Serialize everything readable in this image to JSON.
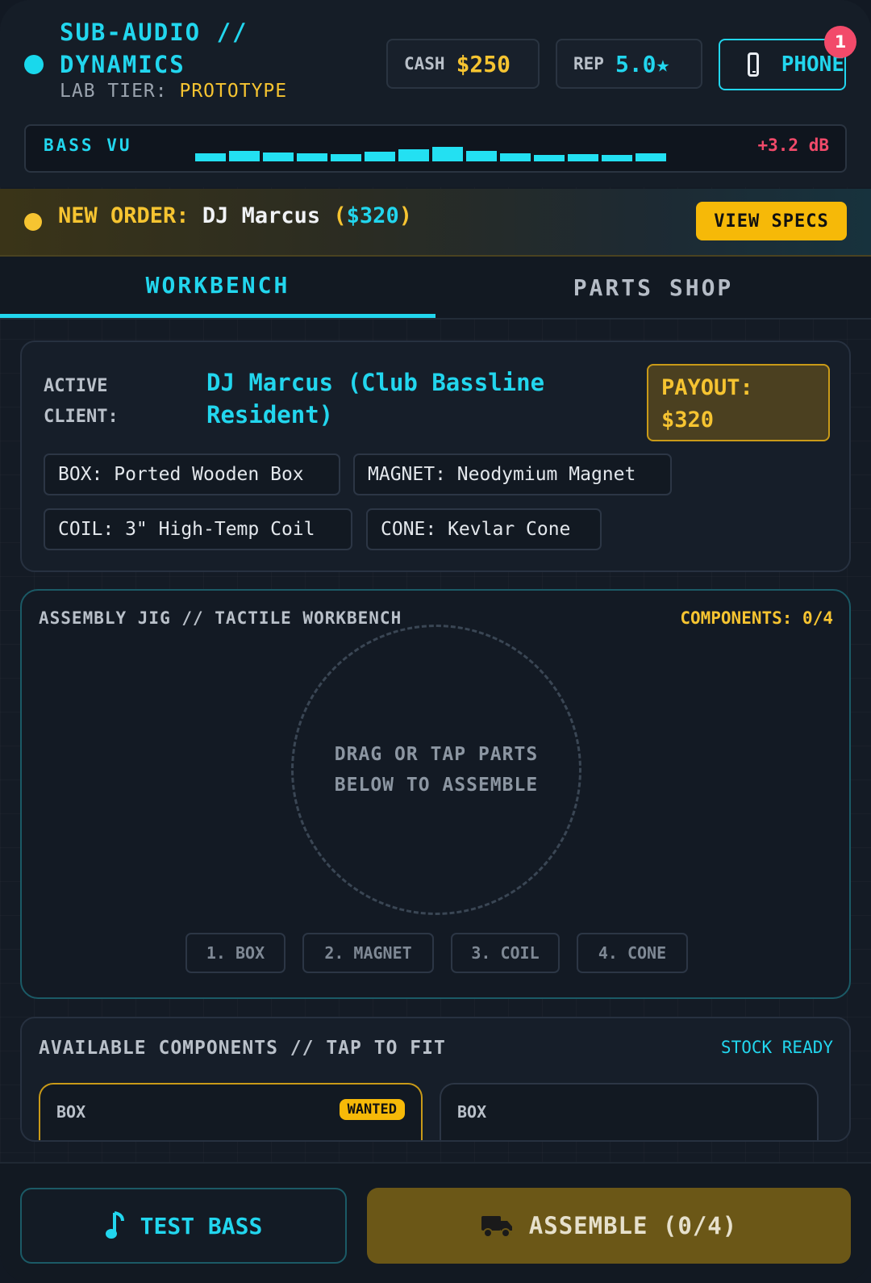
{
  "header": {
    "brand_line1": "SUB-AUDIO //",
    "brand_line2": "DYNAMICS",
    "tier_label": "LAB TIER:",
    "tier_value": "PROTOTYPE",
    "cash_label": "CASH",
    "cash_value": "$250",
    "rep_label": "REP",
    "rep_value": "5.0★",
    "phone_label": "PHONE",
    "phone_badge": "1"
  },
  "vu": {
    "label": "BASS VU",
    "db": "+3.2 dB",
    "levels": [
      0.35,
      0.55,
      0.45,
      0.38,
      0.32,
      0.5,
      0.7,
      0.85,
      0.55,
      0.35,
      0.28,
      0.3,
      0.28,
      0.38
    ]
  },
  "order": {
    "prefix": "NEW ORDER:",
    "client": "DJ Marcus",
    "amount": "$320",
    "button": "VIEW SPECS"
  },
  "tabs": [
    {
      "label": "WORKBENCH",
      "active": true
    },
    {
      "label": "PARTS SHOP",
      "active": false
    }
  ],
  "client": {
    "label_line1": "ACTIVE",
    "label_line2": "CLIENT:",
    "name_line1": "DJ Marcus (Club Bassline",
    "name_line2": "Resident)",
    "payout_label": "PAYOUT:",
    "payout_value": "$320",
    "specs": [
      "BOX: Ported Wooden Box",
      "MAGNET: Neodymium Magnet",
      "COIL: 3\" High-Temp Coil",
      "CONE: Kevlar Cone"
    ]
  },
  "jig": {
    "title": "ASSEMBLY JIG // TACTILE WORKBENCH",
    "count": "COMPONENTS: 0/4",
    "hint_line1": "DRAG OR TAP PARTS",
    "hint_line2": "BELOW TO ASSEMBLE",
    "slots": [
      "1. BOX",
      "2. MAGNET",
      "3. COIL",
      "4. CONE"
    ]
  },
  "available": {
    "title": "AVAILABLE COMPONENTS // TAP TO FIT",
    "stock": "STOCK READY",
    "parts": [
      {
        "label": "BOX",
        "badge": "WANTED"
      },
      {
        "label": "BOX",
        "badge": ""
      }
    ]
  },
  "actions": {
    "test_label": "TEST BASS",
    "assemble_label": "ASSEMBLE (0/4)"
  },
  "colors": {
    "cyan": "#22d6ee",
    "gold": "#f6c431",
    "alert": "#f24a6a"
  }
}
